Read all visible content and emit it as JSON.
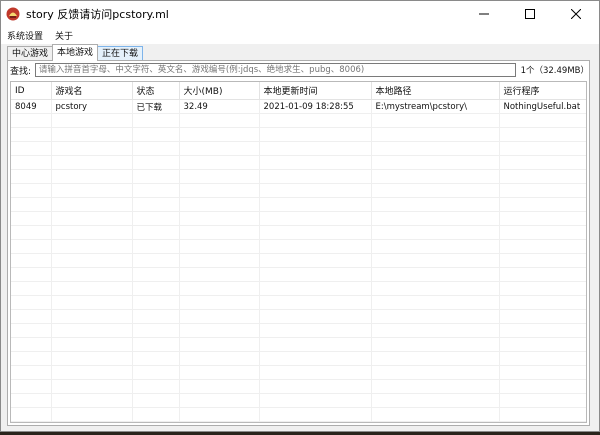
{
  "window": {
    "title": "story 反馈请访问pcstory.ml",
    "controls": [
      "minimize",
      "maximize",
      "close"
    ]
  },
  "menu": {
    "items": [
      "系统设置",
      "关于"
    ]
  },
  "tabs": [
    {
      "label": "中心游戏"
    },
    {
      "label": "本地游戏"
    },
    {
      "label": "正在下载"
    }
  ],
  "search": {
    "label": "查找:",
    "placeholder": "请输入拼音首字母、中文字符、英文名、游戏编号(例:jdqs、绝地求生、pubg、8006)",
    "count": "1个（32.49MB）"
  },
  "table": {
    "columns": [
      "ID",
      "游戏名",
      "状态",
      "大小(MB)",
      "本地更新时间",
      "本地路径",
      "运行程序"
    ],
    "rows": [
      [
        "8049",
        "pcstory",
        "已下载",
        "32.49",
        "2021-01-09 18:28:55",
        "E:\\mystream\\pcstory\\",
        "NothingUseful.bat"
      ]
    ]
  },
  "colors": {
    "accent": "#0078d7",
    "app_icon": "#c0392b"
  }
}
